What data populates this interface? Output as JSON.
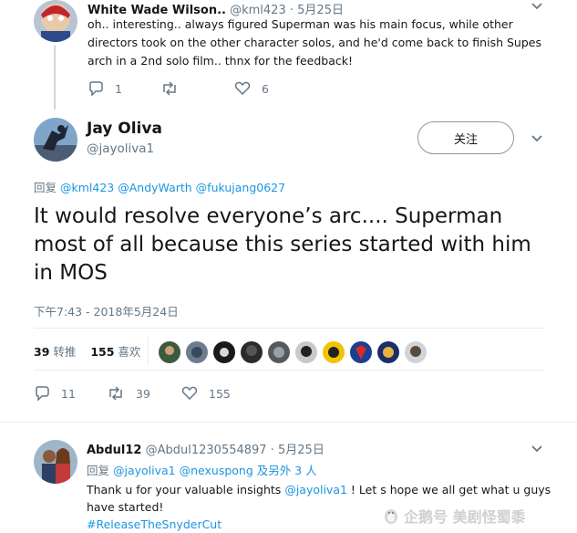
{
  "reply1": {
    "name": "White Wade Wilson..",
    "handle": "@kml423",
    "sep": "·",
    "date": "5月25日",
    "text": "oh.. interesting.. always figured Superman was his main focus, while other directors took on the other character solos, and he'd come back to finish Supes arch in a 2nd solo film.. thnx for the feedback!",
    "reply_count": "1",
    "like_count": "6"
  },
  "main_tweet": {
    "name": "Jay Oliva",
    "handle": "@jayoliva1",
    "follow_label": "关注",
    "reply_to_prefix": "回复",
    "reply_to_users": "@kml423 @AndyWarth @fukujang0627",
    "text": "It would resolve everyone’s arc.... Superman most of all because this series started with him in MOS",
    "timestamp": "下午7:43 - 2018年5月24日",
    "retweet_count": "39",
    "retweet_label": "转推",
    "like_count": "155",
    "like_label": "喜欢",
    "action_reply": "11",
    "action_retweet": "39",
    "action_like": "155"
  },
  "reply2": {
    "name": "Abdul12",
    "handle": "@Abdul1230554897",
    "sep": "·",
    "date": "5月25日",
    "reply_to_prefix": "回复",
    "reply_to_users": "@jayoliva1 @nexuspong",
    "reply_to_suffix": "及另外 3 人",
    "text_mention": "@jayoliva1",
    "text_before": "Thank u for your valuable insights ",
    "text_after": " ! Let s hope we all get what u guys have started!",
    "hashtag": "#ReleaseTheSnyderCut"
  },
  "watermark": {
    "text": "企鹅号 美剧怪蜀黍"
  },
  "colors": {
    "link": "#1b95e0",
    "muted": "#657786",
    "text": "#14171a",
    "thread_line": "#ccd6dd"
  }
}
